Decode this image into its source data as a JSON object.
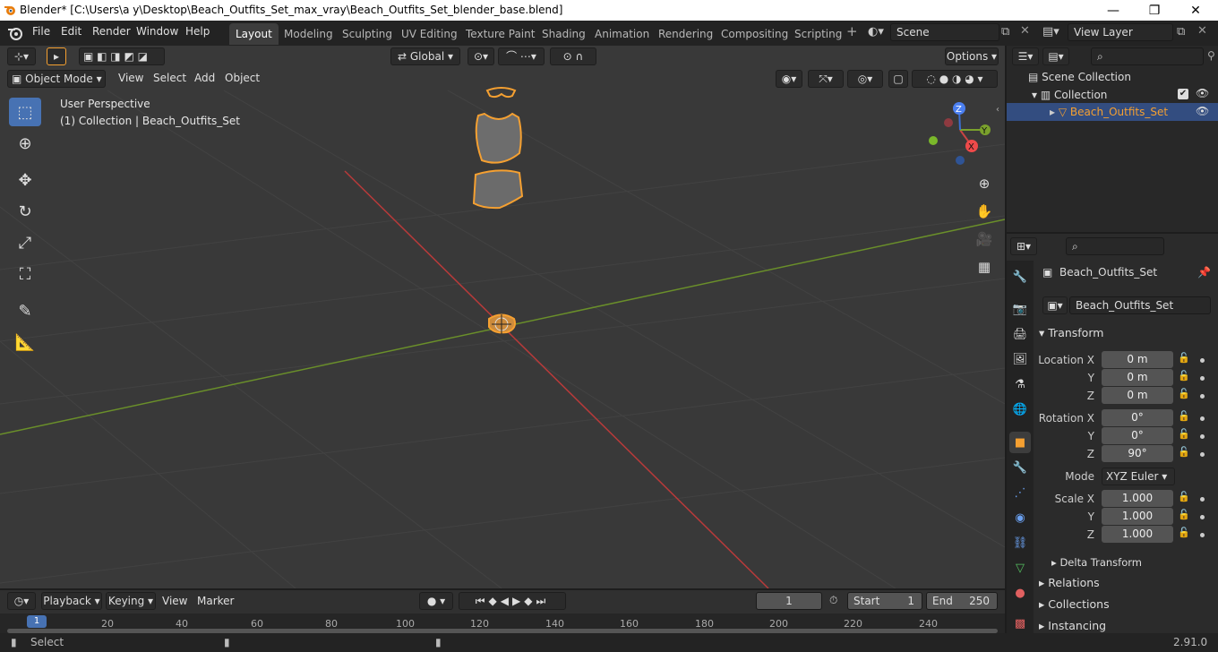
{
  "window": {
    "title": "Blender* [C:\\Users\\a y\\Desktop\\Beach_Outfits_Set_max_vray\\Beach_Outfits_Set_blender_base.blend]",
    "minimize": "—",
    "maximize": "❐",
    "close": "✕"
  },
  "menu": [
    "File",
    "Edit",
    "Render",
    "Window",
    "Help"
  ],
  "workspaces": [
    "Layout",
    "Modeling",
    "Sculpting",
    "UV Editing",
    "Texture Paint",
    "Shading",
    "Animation",
    "Rendering",
    "Compositing",
    "Scripting"
  ],
  "active_workspace": "Layout",
  "add_workspace": "+",
  "scene": {
    "label": "Scene"
  },
  "view_layer": {
    "label": "View Layer"
  },
  "header_tools": {
    "orientation": "Global",
    "options": "Options"
  },
  "viewport": {
    "mode": "Object Mode",
    "menus": [
      "View",
      "Select",
      "Add",
      "Object"
    ],
    "perspective": "User Perspective",
    "collection_info": "(1) Collection | Beach_Outfits_Set",
    "gizmo": {
      "x": "X",
      "y": "Y",
      "z": "Z"
    }
  },
  "outliner": {
    "scene_collection": "Scene Collection",
    "collection": "Collection",
    "object": "Beach_Outfits_Set"
  },
  "properties": {
    "object_name": "Beach_Outfits_Set",
    "data_name": "Beach_Outfits_Set",
    "transform_title": "Transform",
    "location_label": "Location X",
    "y_label": "Y",
    "z_label": "Z",
    "location": {
      "x": "0 m",
      "y": "0 m",
      "z": "0 m"
    },
    "rotation_label": "Rotation X",
    "rotation": {
      "x": "0°",
      "y": "0°",
      "z": "90°"
    },
    "mode_label": "Mode",
    "mode_value": "XYZ Euler",
    "scale_label": "Scale X",
    "scale": {
      "x": "1.000",
      "y": "1.000",
      "z": "1.000"
    },
    "delta_transform": "Delta Transform",
    "relations": "Relations",
    "collections": "Collections",
    "instancing": "Instancing"
  },
  "timeline": {
    "menus": [
      "Playback",
      "Keying",
      "View",
      "Marker"
    ],
    "current_frame": "1",
    "start_label": "Start",
    "start": "1",
    "end_label": "End",
    "end": "250",
    "ticks": [
      "20",
      "40",
      "60",
      "80",
      "100",
      "120",
      "140",
      "160",
      "180",
      "200",
      "220",
      "240"
    ],
    "playhead": "1"
  },
  "status": {
    "select": "Select",
    "version": "2.91.0"
  },
  "colors": {
    "accent": "#4772b3",
    "selection": "#f5a031",
    "x_axis": "#b83a3a",
    "y_axis": "#6a8f2a"
  }
}
